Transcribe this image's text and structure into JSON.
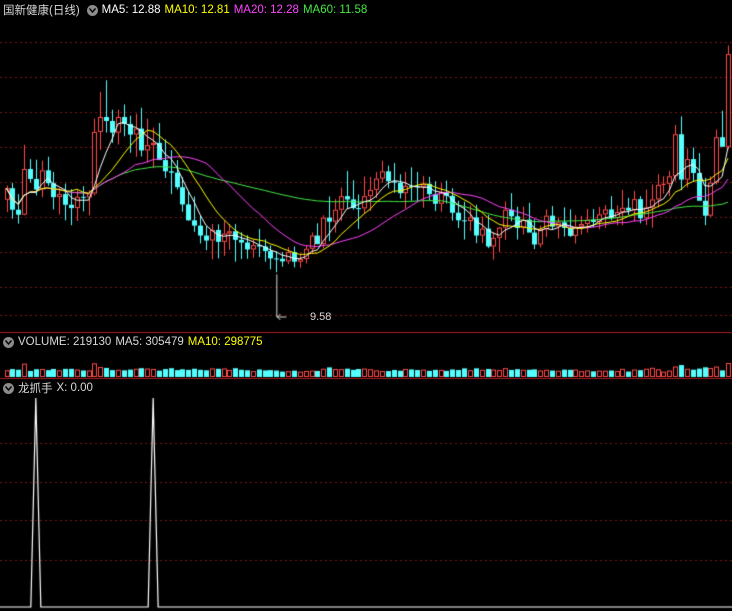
{
  "colors": {
    "background": "#000000",
    "grid": "#7a1515",
    "divider": "#aa1e1e",
    "up": "#ff4a4a",
    "down": "#54ffff",
    "text": "#d8d8d8",
    "ma5": "#ffffff",
    "ma10": "#ffff00",
    "ma20": "#ff44ff",
    "ma60": "#44e844",
    "indicator": "#ffffff"
  },
  "price_panel": {
    "title": "国新健康(日线)",
    "toggle_icon": "chevron-down-icon",
    "ma5_label": "MA5: 12.88",
    "ma10_label": "MA10: 12.81",
    "ma20_label": "MA20: 12.28",
    "ma60_label": "MA60: 11.58",
    "low_marker": "9.58"
  },
  "volume_panel": {
    "toggle_icon": "chevron-down-icon",
    "volume_label": "VOLUME: 219130",
    "ma5_label": "MA5: 305479",
    "ma10_label": "MA10: 298775"
  },
  "indicator_panel": {
    "toggle_icon": "chevron-down-icon",
    "name": "龙抓手",
    "value_label": "X: 0.00"
  },
  "chart_data": [
    {
      "type": "candlestick",
      "panel": "price",
      "ylim": [
        8.2,
        17.2
      ],
      "low_annotation": 9.58,
      "ma_periods": [
        5,
        10,
        20,
        60
      ],
      "ma_last": {
        "MA5": 12.88,
        "MA10": 12.81,
        "MA20": 12.28,
        "MA60": 11.58
      },
      "candles": [
        [
          11.77,
          12.2,
          11.4,
          12.12
        ],
        [
          12.12,
          12.28,
          11.2,
          11.47
        ],
        [
          11.47,
          11.94,
          11.05,
          11.32
        ],
        [
          11.32,
          13.43,
          11.3,
          12.7
        ],
        [
          12.7,
          13.0,
          12.29,
          12.4
        ],
        [
          12.4,
          12.98,
          11.9,
          12.08
        ],
        [
          12.08,
          12.95,
          11.85,
          12.66
        ],
        [
          12.66,
          13.07,
          12.19,
          12.27
        ],
        [
          12.27,
          12.61,
          11.48,
          11.85
        ],
        [
          11.85,
          12.13,
          11.33,
          11.94
        ],
        [
          11.94,
          12.26,
          11.15,
          11.62
        ],
        [
          11.62,
          12.09,
          11.0,
          11.52
        ],
        [
          11.52,
          12.06,
          11.13,
          11.86
        ],
        [
          11.86,
          12.18,
          11.42,
          11.84
        ],
        [
          11.84,
          12.06,
          11.3,
          11.96
        ],
        [
          11.96,
          14.22,
          11.9,
          13.82
        ],
        [
          13.82,
          15.03,
          13.28,
          14.27
        ],
        [
          14.27,
          15.38,
          13.8,
          14.15
        ],
        [
          14.15,
          14.49,
          13.49,
          13.8
        ],
        [
          13.8,
          14.49,
          13.44,
          14.27
        ],
        [
          14.27,
          14.65,
          13.69,
          14.06
        ],
        [
          14.06,
          14.31,
          13.19,
          13.74
        ],
        [
          13.74,
          14.37,
          13.07,
          13.92
        ],
        [
          13.92,
          14.55,
          13.08,
          13.26
        ],
        [
          13.26,
          14.22,
          12.9,
          13.42
        ],
        [
          13.42,
          13.95,
          12.73,
          13.49
        ],
        [
          13.49,
          14.09,
          13.26,
          12.97
        ],
        [
          12.97,
          13.59,
          12.43,
          12.63
        ],
        [
          12.63,
          13.27,
          11.94,
          12.59
        ],
        [
          12.59,
          12.97,
          12.08,
          12.15
        ],
        [
          12.15,
          12.45,
          11.41,
          11.63
        ],
        [
          11.63,
          12.02,
          11.14,
          11.15
        ],
        [
          11.15,
          11.87,
          10.8,
          10.99
        ],
        [
          10.99,
          11.29,
          10.45,
          10.69
        ],
        [
          10.69,
          10.97,
          10.25,
          10.54
        ],
        [
          10.54,
          11.04,
          9.97,
          10.86
        ],
        [
          10.86,
          11.03,
          10.0,
          10.5
        ],
        [
          10.5,
          11.14,
          10.08,
          10.75
        ],
        [
          10.75,
          11.04,
          10.26,
          10.82
        ],
        [
          10.82,
          11.04,
          9.9,
          10.56
        ],
        [
          10.56,
          10.79,
          9.98,
          10.48
        ],
        [
          10.48,
          10.7,
          9.99,
          10.27
        ],
        [
          10.27,
          10.57,
          10.02,
          10.4
        ],
        [
          10.4,
          10.89,
          10.04,
          10.36
        ],
        [
          10.36,
          10.58,
          9.9,
          10.22
        ],
        [
          10.22,
          10.39,
          9.67,
          10.0
        ],
        [
          10.0,
          10.21,
          9.58,
          9.99
        ],
        [
          9.99,
          10.19,
          9.75,
          9.91
        ],
        [
          9.91,
          10.34,
          9.83,
          10.19
        ],
        [
          10.19,
          10.36,
          9.73,
          9.9
        ],
        [
          9.9,
          10.14,
          9.72,
          9.98
        ],
        [
          9.98,
          10.4,
          9.85,
          10.29
        ],
        [
          10.29,
          10.78,
          10.15,
          10.69
        ],
        [
          10.69,
          11.06,
          10.46,
          10.43
        ],
        [
          10.43,
          11.3,
          10.3,
          11.23
        ],
        [
          11.23,
          11.87,
          10.52,
          11.11
        ],
        [
          11.11,
          11.79,
          10.78,
          11.47
        ],
        [
          11.47,
          12.14,
          11.13,
          11.88
        ],
        [
          11.88,
          12.64,
          11.49,
          11.78
        ],
        [
          11.78,
          12.36,
          11.47,
          11.52
        ],
        [
          11.52,
          11.93,
          10.89,
          11.51
        ],
        [
          11.51,
          12.47,
          11.34,
          11.88
        ],
        [
          11.88,
          12.46,
          11.43,
          12.07
        ],
        [
          12.07,
          12.61,
          11.82,
          12.41
        ],
        [
          12.41,
          12.95,
          12.29,
          12.63
        ],
        [
          12.63,
          12.8,
          12.12,
          12.33
        ],
        [
          12.33,
          12.88,
          11.98,
          12.29
        ],
        [
          12.29,
          12.54,
          11.81,
          11.97
        ],
        [
          11.97,
          12.61,
          11.51,
          12.19
        ],
        [
          12.19,
          12.75,
          11.74,
          12.18
        ],
        [
          12.18,
          12.61,
          11.73,
          12.16
        ],
        [
          12.16,
          12.49,
          11.53,
          12.25
        ],
        [
          12.25,
          12.46,
          11.75,
          11.94
        ],
        [
          11.94,
          12.33,
          11.43,
          11.65
        ],
        [
          11.65,
          12.27,
          11.41,
          12.0
        ],
        [
          12.0,
          12.35,
          11.66,
          11.89
        ],
        [
          11.89,
          12.12,
          11.14,
          11.38
        ],
        [
          11.38,
          11.74,
          10.92,
          11.15
        ],
        [
          11.15,
          11.71,
          10.57,
          11.13
        ],
        [
          11.13,
          11.6,
          10.83,
          11.24
        ],
        [
          11.24,
          11.62,
          10.46,
          10.69
        ],
        [
          10.69,
          11.27,
          10.46,
          10.9
        ],
        [
          10.9,
          11.31,
          10.31,
          10.36
        ],
        [
          10.36,
          10.79,
          9.96,
          10.62
        ],
        [
          10.62,
          10.95,
          10.19,
          10.93
        ],
        [
          10.93,
          11.72,
          10.56,
          11.47
        ],
        [
          11.47,
          11.97,
          11.12,
          11.27
        ],
        [
          11.27,
          11.56,
          10.57,
          10.92
        ],
        [
          10.92,
          11.56,
          10.72,
          11.17
        ],
        [
          11.17,
          11.68,
          10.82,
          10.78
        ],
        [
          10.78,
          11.18,
          10.28,
          10.42
        ],
        [
          10.42,
          10.99,
          10.33,
          10.88
        ],
        [
          10.88,
          11.48,
          10.65,
          11.29
        ],
        [
          11.29,
          11.58,
          10.87,
          10.96
        ],
        [
          10.96,
          11.24,
          10.6,
          11.09
        ],
        [
          11.09,
          11.54,
          10.66,
          10.92
        ],
        [
          10.92,
          11.48,
          10.65,
          10.68
        ],
        [
          10.68,
          11.31,
          10.45,
          10.96
        ],
        [
          10.96,
          11.28,
          10.72,
          11.04
        ],
        [
          11.04,
          11.49,
          10.78,
          11.17
        ],
        [
          11.17,
          11.49,
          10.94,
          11.1
        ],
        [
          11.1,
          11.55,
          10.88,
          11.33
        ],
        [
          11.33,
          11.61,
          10.92,
          11.48
        ],
        [
          11.48,
          11.88,
          11.15,
          11.22
        ],
        [
          11.22,
          11.6,
          11.0,
          11.4
        ],
        [
          11.4,
          12.07,
          11.0,
          11.53
        ],
        [
          11.53,
          11.83,
          11.31,
          11.45
        ],
        [
          11.45,
          12.04,
          11.11,
          11.79
        ],
        [
          11.79,
          11.88,
          11.06,
          11.21
        ],
        [
          11.21,
          12.08,
          11.01,
          11.54
        ],
        [
          11.54,
          12.23,
          10.93,
          11.78
        ],
        [
          11.78,
          12.54,
          11.54,
          12.22
        ],
        [
          12.22,
          12.48,
          11.96,
          12.25
        ],
        [
          12.25,
          12.64,
          11.88,
          12.48
        ],
        [
          12.48,
          14.03,
          12.33,
          13.75
        ],
        [
          13.75,
          14.29,
          12.06,
          12.38
        ],
        [
          12.38,
          13.32,
          12.14,
          13.0
        ],
        [
          13.0,
          13.35,
          12.33,
          12.58
        ],
        [
          12.58,
          13.18,
          11.95,
          11.74
        ],
        [
          11.74,
          12.43,
          11.0,
          11.29
        ],
        [
          11.29,
          12.48,
          11.25,
          12.29
        ],
        [
          12.29,
          13.89,
          12.23,
          13.66
        ],
        [
          13.66,
          14.46,
          13.56,
          13.37
        ],
        [
          13.37,
          16.43,
          13.3,
          16.17
        ]
      ]
    },
    {
      "type": "bar",
      "panel": "volume",
      "last_volume": 219130,
      "ma5": 305479,
      "ma10": 298775
    },
    {
      "type": "line",
      "panel": "indicator",
      "name": "龙抓手",
      "current_value": 0.0,
      "spike_bars": [
        5,
        25
      ],
      "spike_value": 1
    }
  ]
}
